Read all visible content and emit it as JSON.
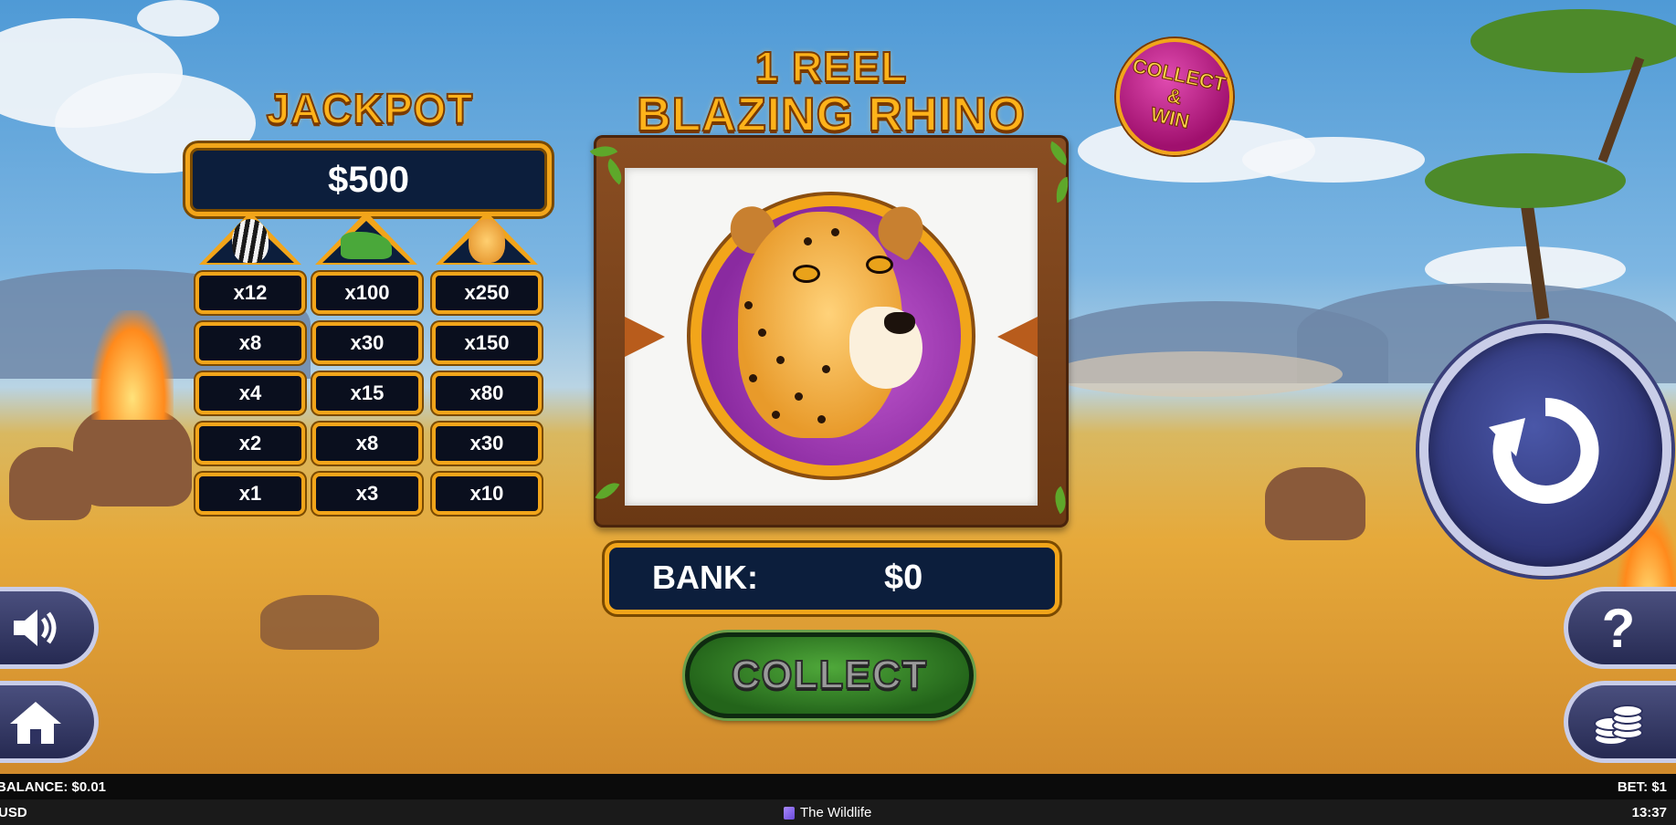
{
  "game": {
    "title_line_1": "1 REEL",
    "title_line_2": "BLAZING RHINO",
    "badge_text": "COLLECT\n&\nWIN"
  },
  "jackpot": {
    "title": "JACKPOT",
    "value": "$500"
  },
  "paytable": {
    "columns": [
      {
        "animal": "zebra",
        "multipliers": [
          "x12",
          "x8",
          "x4",
          "x2",
          "x1"
        ]
      },
      {
        "animal": "crocodile",
        "multipliers": [
          "x100",
          "x30",
          "x15",
          "x8",
          "x3"
        ]
      },
      {
        "animal": "cheetah",
        "multipliers": [
          "x250",
          "x150",
          "x80",
          "x30",
          "x10"
        ]
      }
    ]
  },
  "reel": {
    "current_symbol": "cheetah"
  },
  "bank": {
    "label": "BANK:",
    "value": "$0"
  },
  "buttons": {
    "collect_label": "COLLECT",
    "help_label": "?",
    "spin_icon": "refresh-icon",
    "sound_icon": "speaker-icon",
    "home_icon": "home-icon",
    "bet_icon": "coins-icon"
  },
  "status_bar": {
    "balance": "BALANCE: $0.01",
    "bet": "BET: $1",
    "currency": "USD",
    "title": "The Wildlife",
    "time": "13:37"
  },
  "colors": {
    "gold": "#f2a51a",
    "panel": "#0c1e3c",
    "collect_green": "#3a8a2a",
    "spin_blue": "#2a2f6e"
  }
}
